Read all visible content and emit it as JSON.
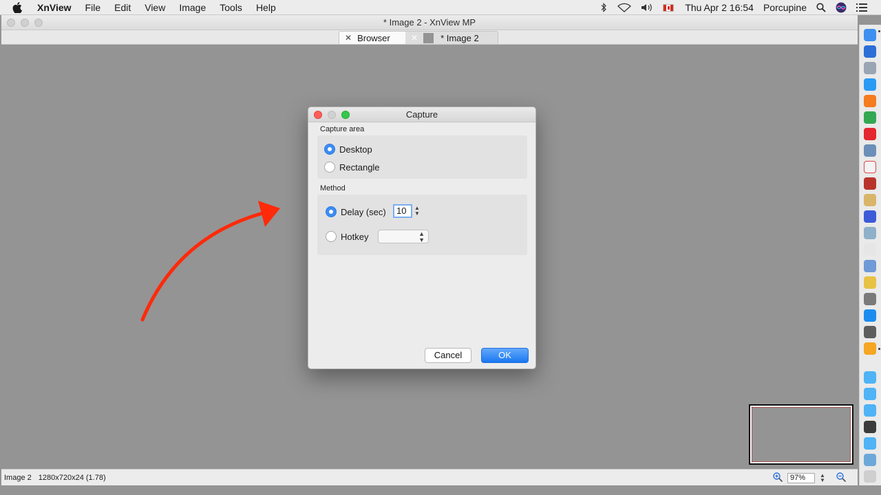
{
  "menubar": {
    "app_name": "XnView",
    "items": [
      "File",
      "Edit",
      "View",
      "Image",
      "Tools",
      "Help"
    ],
    "clock": "Thu Apr 2  16:54",
    "user": "Porcupine"
  },
  "window": {
    "title": "* Image 2 - XnView MP",
    "tabs": [
      {
        "label": "Browser"
      },
      {
        "label": "* Image 2"
      }
    ]
  },
  "dialog": {
    "title": "Capture",
    "capture_area": {
      "label": "Capture area",
      "options": [
        "Desktop",
        "Rectangle"
      ],
      "selected": "Desktop"
    },
    "method": {
      "label": "Method",
      "delay_label": "Delay (sec)",
      "delay_value": "10",
      "hotkey_label": "Hotkey",
      "selected": "Delay (sec)"
    },
    "cancel_label": "Cancel",
    "ok_label": "OK"
  },
  "statusbar": {
    "image_name": "Image 2",
    "image_info": "1280x720x24 (1.78)",
    "zoom": "97%"
  },
  "colors": {
    "accent": "#3b8cf5",
    "arrow": "#ff2a0a",
    "canvas": "#949494"
  },
  "dock_icons": [
    "finder-icon",
    "siri-icon",
    "launchpad-icon",
    "safari-icon",
    "firefox-icon",
    "chrome-icon",
    "opera-icon",
    "preview-icon",
    "calendar-icon",
    "dictionary-icon",
    "notes-icon",
    "bitdefender-icon",
    "xnview-icon",
    "script-icon",
    "photos-icon",
    "imageoptim-icon",
    "gimp-icon",
    "appstore-icon",
    "system-preferences-icon",
    "xnview-mp-icon",
    "folder-icon",
    "folder-icon",
    "folder-icon",
    "photo-booth-icon",
    "folder-icon",
    "image-icon",
    "trash-icon"
  ]
}
